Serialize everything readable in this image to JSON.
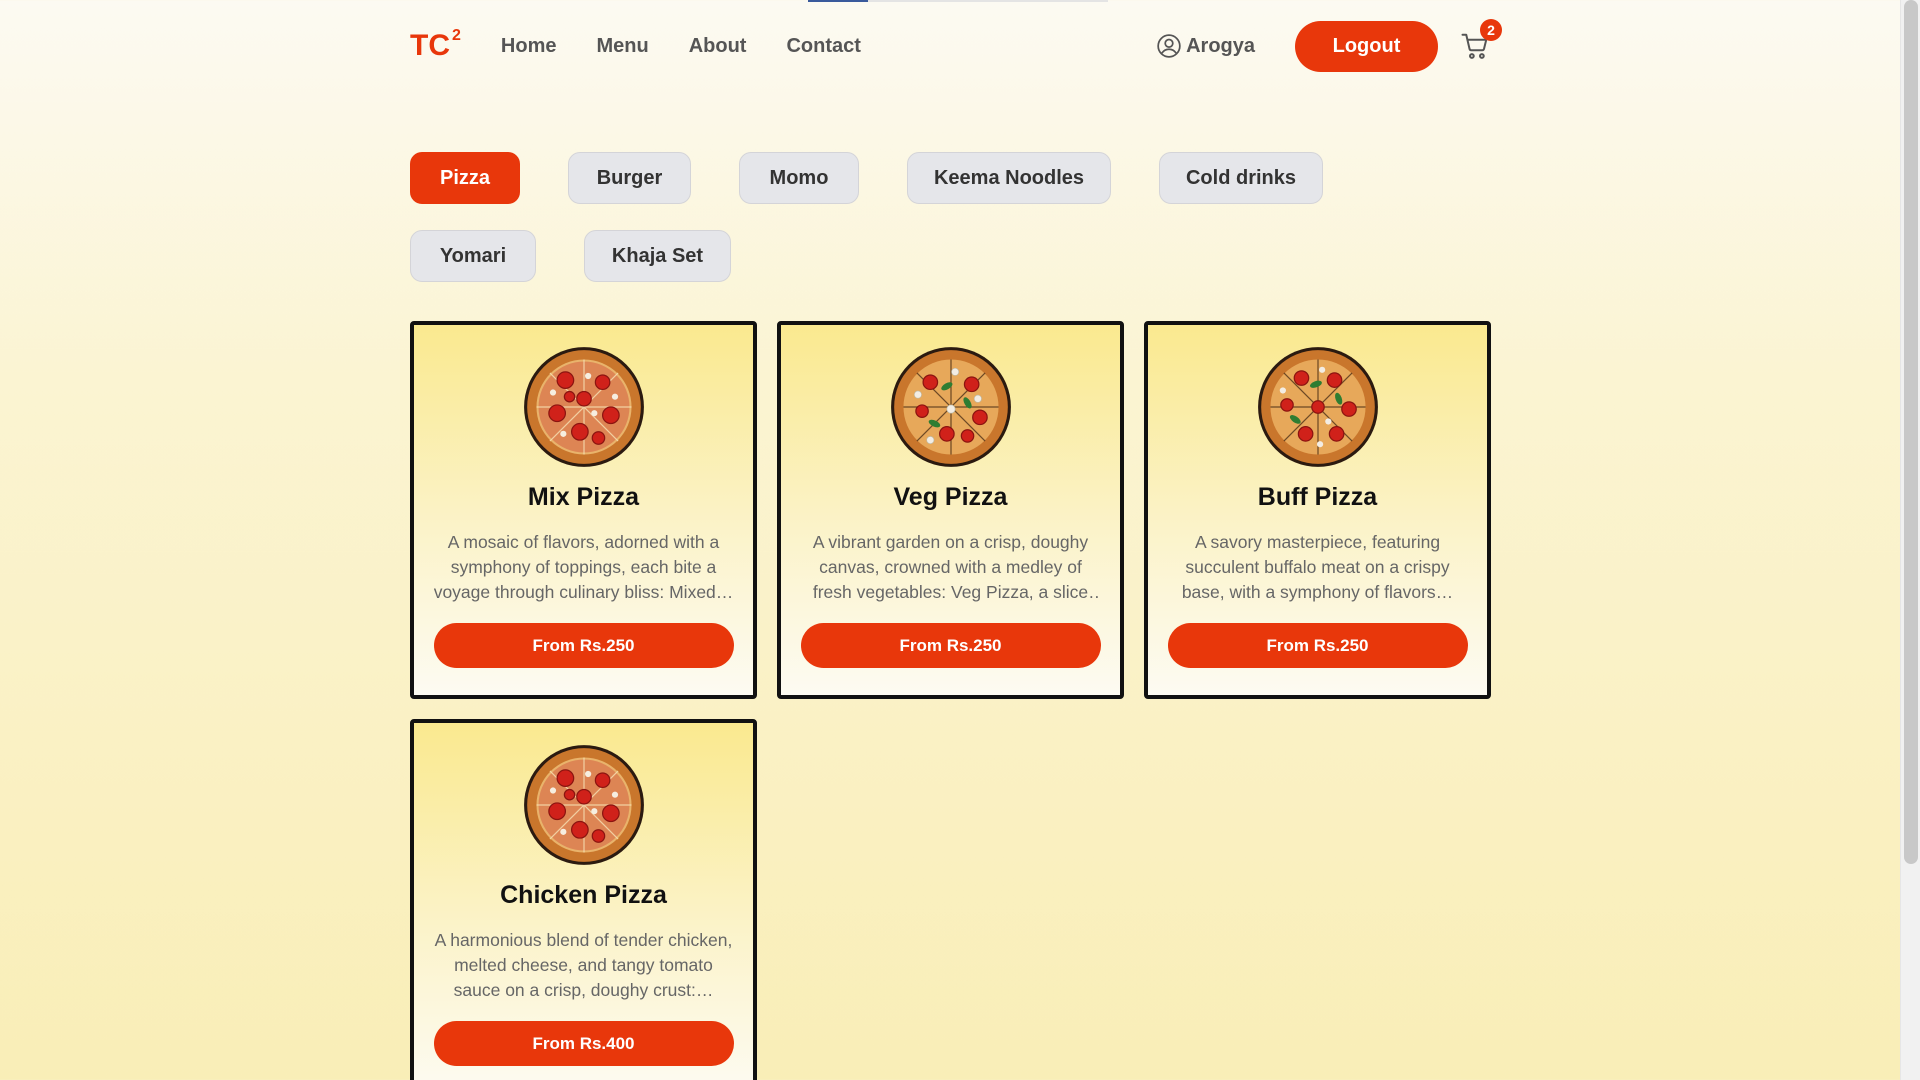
{
  "brand": {
    "name": "TC",
    "superscript": "2"
  },
  "nav": {
    "links": [
      "Home",
      "Menu",
      "About",
      "Contact"
    ]
  },
  "user": {
    "name": "Arogya"
  },
  "actions": {
    "logout_label": "Logout",
    "cart_count": "2"
  },
  "categories": [
    {
      "label": "Pizza",
      "active": true
    },
    {
      "label": "Burger",
      "active": false
    },
    {
      "label": "Momo",
      "active": false
    },
    {
      "label": "Keema Noodles",
      "active": false
    },
    {
      "label": "Cold drinks",
      "active": false
    },
    {
      "label": "Yomari",
      "active": false
    },
    {
      "label": "Khaja Set",
      "active": false
    }
  ],
  "products": [
    {
      "title": "Mix Pizza",
      "description": "A mosaic of flavors, adorned with a symphony of toppings, each bite a voyage through culinary bliss: Mixed…",
      "price_label": "From Rs.250"
    },
    {
      "title": "Veg Pizza",
      "description": "A vibrant garden on a crisp, doughy canvas, crowned with a medley of fresh vegetables: Veg Pizza, a slice o…",
      "price_label": "From Rs.250"
    },
    {
      "title": "Buff Pizza",
      "description": "A savory masterpiece, featuring succulent buffalo meat on a crispy base, with a symphony of flavors…",
      "price_label": "From Rs.250"
    },
    {
      "title": "Chicken Pizza",
      "description": "A harmonious blend of tender chicken, melted cheese, and tangy tomato sauce on a crisp, doughy crust:…",
      "price_label": "From Rs.400"
    }
  ],
  "colors": {
    "accent": "#e8370b",
    "chip_bg": "#e5e6ea"
  }
}
